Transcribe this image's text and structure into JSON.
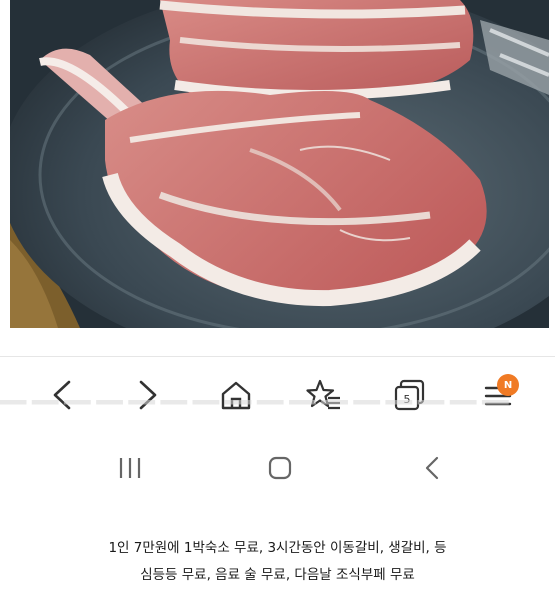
{
  "photo": {
    "subject": "raw pork chop cuts on a metal platter",
    "colors": {
      "meat": "#c76b6b",
      "fat": "#efe4de",
      "platter": "#33404a",
      "gold_trim": "#8a6a32"
    }
  },
  "toolbar": {
    "back_icon": "chevron-left-icon",
    "forward_icon": "chevron-right-icon",
    "home_icon": "home-icon",
    "bookmark_icon": "star-list-icon",
    "tabs_icon": "tabs-icon",
    "tabs_count": "5",
    "menu_icon": "menu-icon",
    "menu_badge": "N",
    "accent": "#f07a24"
  },
  "system_nav": {
    "recents_icon": "recents-icon",
    "home_icon": "circle-home-icon",
    "back_icon": "chevron-back-icon"
  },
  "caption": {
    "line1": "1인 7만원에 1박숙소 무료, 3시간동안 이동갈비, 생갈비, 등",
    "line2": "심등등 무료, 음료 술 무료, 다음날 조식부페 무료"
  }
}
